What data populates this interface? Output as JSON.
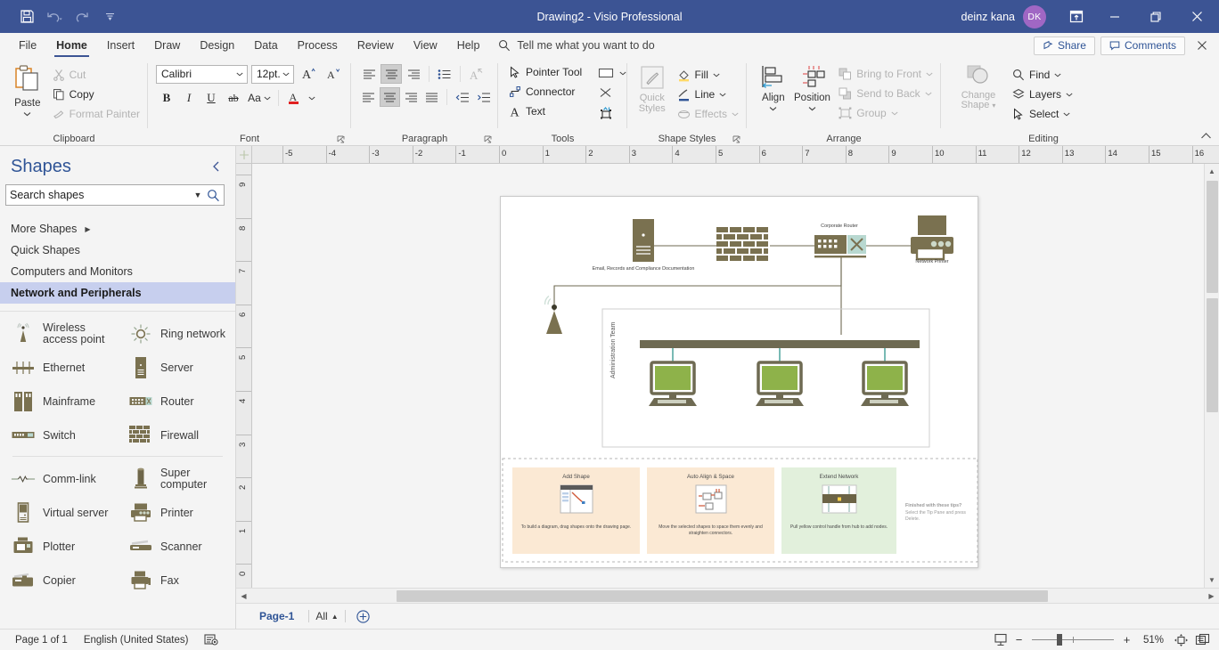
{
  "titlebar": {
    "doc_title": "Drawing2  -  Visio Professional",
    "account_name": "deinz kana",
    "avatar_initials": "DK",
    "qat": [
      {
        "name": "save-icon",
        "label": "Save"
      },
      {
        "name": "undo-icon",
        "label": "Undo"
      },
      {
        "name": "redo-icon",
        "label": "Redo"
      },
      {
        "name": "customize-qat-icon",
        "label": "Customize Quick Access Toolbar"
      }
    ],
    "window_controls": [
      {
        "name": "ribbon-display-options-icon",
        "label": "Ribbon Display Options"
      },
      {
        "name": "minimize-icon",
        "label": "Minimize"
      },
      {
        "name": "restore-icon",
        "label": "Restore Down"
      },
      {
        "name": "close-icon",
        "label": "Close"
      }
    ]
  },
  "tabbar": {
    "tabs": [
      {
        "label": "File",
        "active": false
      },
      {
        "label": "Home",
        "active": true
      },
      {
        "label": "Insert",
        "active": false
      },
      {
        "label": "Draw",
        "active": false
      },
      {
        "label": "Design",
        "active": false
      },
      {
        "label": "Data",
        "active": false
      },
      {
        "label": "Process",
        "active": false
      },
      {
        "label": "Review",
        "active": false
      },
      {
        "label": "View",
        "active": false
      },
      {
        "label": "Help",
        "active": false
      }
    ],
    "tellme_placeholder": "Tell me what you want to do",
    "share_label": "Share",
    "comments_label": "Comments"
  },
  "ribbon": {
    "clipboard": {
      "title": "Clipboard",
      "paste_label": "Paste",
      "cut_label": "Cut",
      "copy_label": "Copy",
      "format_painter_label": "Format Painter"
    },
    "font": {
      "title": "Font",
      "font_name": "Calibri",
      "font_size": "12pt.",
      "grow_label": "A",
      "shrink_label": "A",
      "bold_label": "B",
      "italic_label": "I",
      "underline_label": "U",
      "strike_label": "ab",
      "case_label": "Aa",
      "color_label": "A"
    },
    "paragraph": {
      "title": "Paragraph"
    },
    "tools": {
      "title": "Tools",
      "pointer_label": "Pointer Tool",
      "connector_label": "Connector",
      "text_label": "Text"
    },
    "shape_styles": {
      "title": "Shape Styles",
      "quick_styles_label": "Quick Styles",
      "fill_label": "Fill",
      "line_label": "Line",
      "effects_label": "Effects"
    },
    "arrange": {
      "title": "Arrange",
      "align_label": "Align",
      "position_label": "Position",
      "bring_front_label": "Bring to Front",
      "send_back_label": "Send to Back",
      "group_label": "Group"
    },
    "editing": {
      "title": "Editing",
      "change_shape_label": "Change Shape",
      "find_label": "Find",
      "layers_label": "Layers",
      "select_label": "Select"
    }
  },
  "shapes_panel": {
    "title": "Shapes",
    "search_value": "Search shapes",
    "stencils": [
      {
        "label": "More Shapes",
        "has_chevron": true,
        "active": false
      },
      {
        "label": "Quick Shapes",
        "has_chevron": false,
        "active": false
      },
      {
        "label": "Computers and Monitors",
        "has_chevron": false,
        "active": false
      },
      {
        "label": "Network and Peripherals",
        "has_chevron": false,
        "active": true
      }
    ],
    "shapes": [
      {
        "label": "Wireless access point",
        "icon": "wireless-access-point-icon"
      },
      {
        "label": "Ring network",
        "icon": "ring-network-icon"
      },
      {
        "label": "Ethernet",
        "icon": "ethernet-icon"
      },
      {
        "label": "Server",
        "icon": "server-icon"
      },
      {
        "label": "Mainframe",
        "icon": "mainframe-icon"
      },
      {
        "label": "Router",
        "icon": "router-icon"
      },
      {
        "label": "Switch",
        "icon": "switch-icon"
      },
      {
        "label": "Firewall",
        "icon": "firewall-icon"
      },
      {
        "label": "Comm-link",
        "icon": "comm-link-icon"
      },
      {
        "label": "Super computer",
        "icon": "super-computer-icon"
      },
      {
        "label": "Virtual server",
        "icon": "virtual-server-icon"
      },
      {
        "label": "Printer",
        "icon": "printer-icon"
      },
      {
        "label": "Plotter",
        "icon": "plotter-icon"
      },
      {
        "label": "Scanner",
        "icon": "scanner-icon"
      },
      {
        "label": "Copier",
        "icon": "copier-icon"
      },
      {
        "label": "Fax",
        "icon": "fax-icon"
      }
    ]
  },
  "rulers": {
    "horizontal_labels": [
      "-5",
      "-4",
      "-3",
      "-2",
      "-1",
      "0",
      "1",
      "2",
      "3",
      "4",
      "5",
      "6",
      "7",
      "8",
      "9",
      "10",
      "11",
      "12",
      "13",
      "14",
      "15",
      "16"
    ],
    "vertical_labels": [
      "9",
      "8",
      "7",
      "6",
      "5",
      "4",
      "3",
      "2",
      "1",
      "0"
    ]
  },
  "diagram": {
    "nodes": [
      {
        "name": "server-shape",
        "label": "Email, Records and Compliance Documentation"
      },
      {
        "name": "firewall-shape",
        "label": ""
      },
      {
        "name": "router-shape",
        "label": "Corporate Router"
      },
      {
        "name": "printer-shape",
        "label": "Network Printer"
      },
      {
        "name": "wireless-access-point-shape",
        "label": ""
      }
    ],
    "container_label": "Administration Team",
    "colors": {
      "shape_fill": "#7a7150",
      "monitor_screen": "#8eb24a",
      "connector": "#6e6a52",
      "link_teal": "#3f9c93"
    }
  },
  "tips": {
    "cards": [
      {
        "title": "Add Shape",
        "desc": "To build a diagram, drag shapes onto the drawing page.",
        "bg": "#fbe9d4",
        "icon": "add-shape-tip-icon"
      },
      {
        "title": "Auto Align & Space",
        "desc": "Move the selected shapes to space them evenly and straighten connectors.",
        "bg": "#fbe9d4",
        "icon": "auto-align-tip-icon"
      },
      {
        "title": "Extend Network",
        "desc": "Pull yellow control handle from hub to add nodes.",
        "bg": "#e2f0dc",
        "icon": "extend-network-tip-icon"
      }
    ],
    "finished_title": "Finished with these tips?",
    "finished_desc": "Select the Tip Pane and press Delete."
  },
  "pagetabs": {
    "page_label": "Page-1",
    "all_label": "All",
    "add_label": "+"
  },
  "statusbar": {
    "page_status": "Page 1 of 1",
    "language": "English (United States)",
    "zoom_percent": "51%",
    "zoom_minus": "−",
    "zoom_plus": "+"
  }
}
